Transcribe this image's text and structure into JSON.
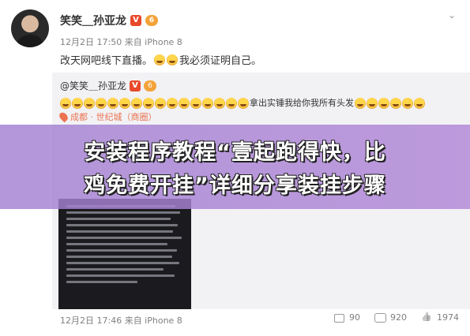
{
  "post": {
    "author": "笑笑＿孙亚龙",
    "meta": "12月2日 17:50 来自 iPhone 8",
    "text": "改天网吧线下直播。",
    "text_after_emoji": "我必须证明自己。"
  },
  "repost": {
    "author": "@笑笑＿孙亚龙",
    "text": "拿出实锤我给你我所有头发",
    "location": "成都 · 世纪城（商圈）"
  },
  "banner": {
    "line1": "安装程序教程“壹起跑得快，比",
    "line2": "鸡免费开挂”详细分享装挂步骤"
  },
  "footer": {
    "meta": "12月2日 17:46 来自 iPhone 8",
    "reposts": "90",
    "comments": "920",
    "likes": "1974"
  },
  "icons": {
    "chevron": "chevron-down-icon",
    "verified": "verified-v-icon",
    "level": "level-badge-icon",
    "location": "location-pin-icon",
    "repost": "repost-icon",
    "comment": "comment-icon",
    "like": "like-icon"
  },
  "colors": {
    "accent_orange": "#eb7350",
    "banner_purple": "#a880d2",
    "meta_gray": "#808080"
  }
}
